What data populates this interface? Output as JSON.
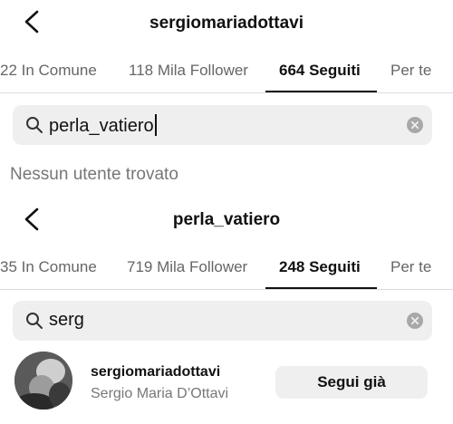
{
  "screens": [
    {
      "title": "sergiomariadottavi",
      "tabs": [
        {
          "label": "22 In Comune"
        },
        {
          "label": "118 Mila Follower"
        },
        {
          "label": "664 Seguiti"
        },
        {
          "label": "Per te"
        }
      ],
      "active_tab": "664 Seguiti",
      "search": {
        "query": "perla_vatiero"
      },
      "empty_message": "Nessun utente trovato"
    },
    {
      "title": "perla_vatiero",
      "tabs": [
        {
          "label": "35 In Comune"
        },
        {
          "label": "719 Mila Follower"
        },
        {
          "label": "248 Seguiti"
        },
        {
          "label": "Per te"
        }
      ],
      "active_tab": "248 Seguiti",
      "search": {
        "query": "serg"
      },
      "result": {
        "username": "sergiomariadottavi",
        "full_name": "Sergio Maria D’Ottavi",
        "button_label": "Segui già"
      }
    }
  ],
  "icons": {
    "back": "chevron-left-icon",
    "search": "magnifier-icon",
    "clear": "clear-circle-icon"
  },
  "colors": {
    "search_bg": "#efefef",
    "muted_text": "#777777",
    "divider": "#dcdcdc"
  }
}
